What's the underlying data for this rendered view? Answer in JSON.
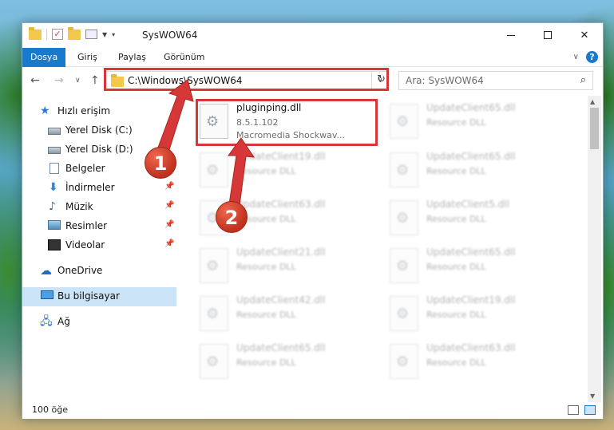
{
  "window": {
    "title": "SysWOW64",
    "min_label": "",
    "max_label": "",
    "close_label": "✕"
  },
  "ribbon": {
    "tabs": [
      "Dosya",
      "Giriş",
      "Paylaş",
      "Görünüm"
    ],
    "help": "?"
  },
  "address": {
    "path": "C:\\Windows\\SysWOW64",
    "search_placeholder": "Ara: SysWOW64"
  },
  "sidebar": {
    "items": [
      {
        "label": "Hızlı erişim",
        "icon": "star-icon"
      },
      {
        "label": "Yerel Disk (C:)",
        "icon": "drive-icon"
      },
      {
        "label": "Yerel Disk (D:)",
        "icon": "drive-icon"
      },
      {
        "label": "Belgeler",
        "icon": "documents-icon"
      },
      {
        "label": "İndirmeler",
        "icon": "downloads-icon"
      },
      {
        "label": "Müzik",
        "icon": "music-icon"
      },
      {
        "label": "Resimler",
        "icon": "pictures-icon"
      },
      {
        "label": "Videolar",
        "icon": "videos-icon"
      },
      {
        "label": "OneDrive",
        "icon": "cloud-icon"
      },
      {
        "label": "Bu bilgisayar",
        "icon": "computer-icon"
      },
      {
        "label": "Ağ",
        "icon": "network-icon"
      }
    ]
  },
  "files": {
    "selected": {
      "name": "pluginping.dll",
      "version": "8.5.1.102",
      "description": "Macromedia Shockwav..."
    },
    "left_column": [
      {
        "name": "UpdateClient19.dll",
        "desc": "Resource DLL"
      },
      {
        "name": "UpdateClient63.dll",
        "desc": "Resource DLL"
      },
      {
        "name": "UpdateClient21.dll",
        "desc": "Resource DLL"
      },
      {
        "name": "UpdateClient42.dll",
        "desc": "Resource DLL"
      },
      {
        "name": "UpdateClient65.dll",
        "desc": "Resource DLL"
      }
    ],
    "right_column": [
      {
        "name": "UpdateClient65.dll",
        "desc": "Resource DLL"
      },
      {
        "name": "UpdateClient65.dll",
        "desc": "Resource DLL"
      },
      {
        "name": "UpdateClient5.dll",
        "desc": "Resource DLL"
      },
      {
        "name": "UpdateClient65.dll",
        "desc": "Resource DLL"
      },
      {
        "name": "UpdateClient19.dll",
        "desc": "Resource DLL"
      },
      {
        "name": "UpdateClient63.dll",
        "desc": "Resource DLL"
      }
    ]
  },
  "status": {
    "item_count": "100 öğe"
  },
  "annotations": {
    "step1": "1",
    "step2": "2",
    "color": "#d6383a"
  }
}
